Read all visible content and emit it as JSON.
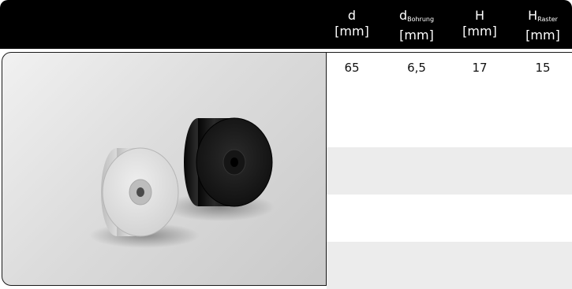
{
  "header": {
    "columns": [
      {
        "symbol": "d",
        "subscript": "",
        "unit": "[mm]"
      },
      {
        "symbol": "d",
        "subscript": "Bohrung",
        "unit": "[mm]"
      },
      {
        "symbol": "H",
        "subscript": "",
        "unit": "[mm]"
      },
      {
        "symbol": "H",
        "subscript": "Raster",
        "unit": "[mm]"
      }
    ]
  },
  "table": {
    "rows": [
      [
        "65",
        "6,5",
        "17",
        "15"
      ]
    ]
  },
  "colors": {
    "header_bg": "#000000",
    "header_text": "#ffffff",
    "stripe": "#ececec"
  },
  "photo": {
    "subject": "two cylindrical spacer discs, one light grey and one black"
  }
}
